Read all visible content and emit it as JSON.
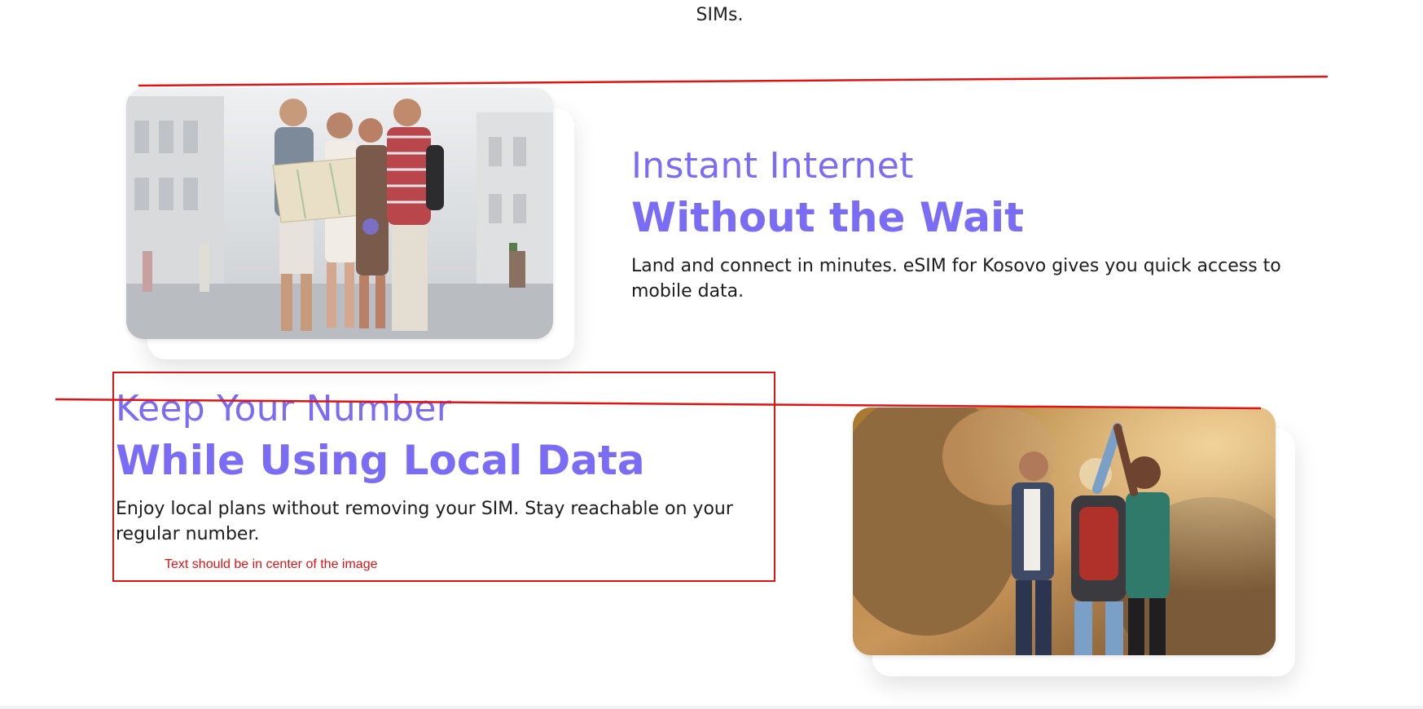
{
  "intro": {
    "text": "SIMs."
  },
  "features": [
    {
      "title_light": "Instant Internet",
      "title_bold": "Without the Wait",
      "description": "Land and connect in minutes. eSIM for Kosovo gives you quick access to mobile data."
    },
    {
      "title_light": "Keep Your Number",
      "title_bold": "While Using Local Data",
      "description": "Enjoy local plans without removing your SIM. Stay reachable on your regular number."
    }
  ],
  "annotation": {
    "note": "Text should be in center of the image"
  },
  "colors": {
    "accent": "#7b6cf6",
    "annotation": "#e01313"
  },
  "icons": [
    "travelers-map-photo",
    "hikers-high-five-photo"
  ]
}
